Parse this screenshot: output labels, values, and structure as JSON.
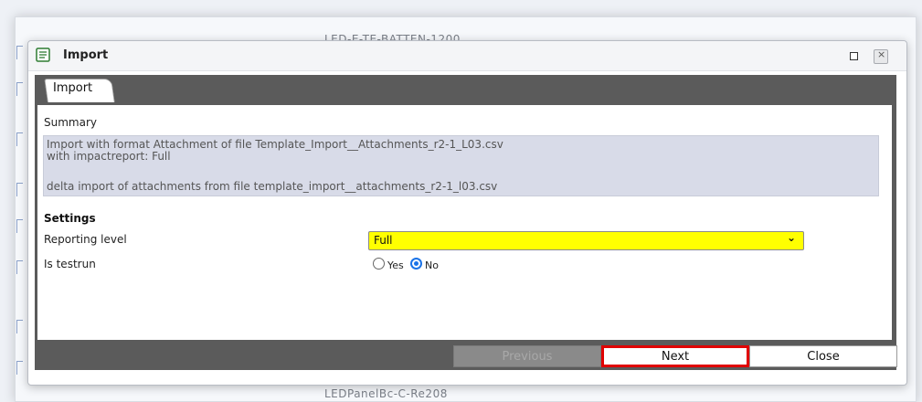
{
  "background": {
    "top_text": "LED-E-TE-BATTEN-1200",
    "bottom_text": "LEDPanelBc-C-Re208"
  },
  "dialog": {
    "title": "Import",
    "icon": "document-list-icon",
    "maximize_icon": "maximize-icon",
    "close_icon": "close-icon"
  },
  "tabs": [
    {
      "label": "Import",
      "active": true
    }
  ],
  "summary": {
    "label": "Summary",
    "lines": [
      "Import with format Attachment of file Template_Import__Attachments_r2-1_L03.csv",
      "with impactreport: Full",
      "",
      "delta import of attachments from file template_import__attachments_r2-1_l03.csv"
    ]
  },
  "settings": {
    "heading": "Settings",
    "reporting_level": {
      "label": "Reporting level",
      "value": "Full"
    },
    "is_testrun": {
      "label": "Is testrun",
      "options": [
        {
          "label": "Yes",
          "checked": false
        },
        {
          "label": "No",
          "checked": true
        }
      ]
    }
  },
  "buttons": {
    "previous": "Previous",
    "next": "Next",
    "close": "Close"
  },
  "colors": {
    "select_bg": "#ffff00",
    "next_highlight": "#e00000",
    "frame": "#5b5b5b",
    "summary_bg": "#d8dbe8"
  }
}
